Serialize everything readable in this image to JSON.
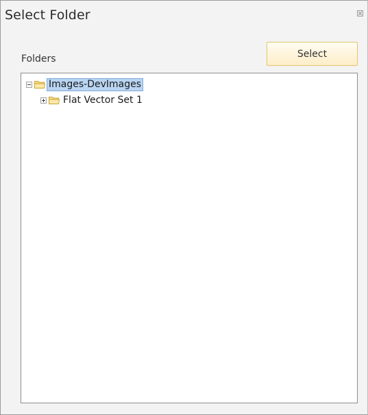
{
  "dialog": {
    "title": "Select Folder",
    "close_icon": "close-icon"
  },
  "toolbar": {
    "folders_label": "Folders",
    "select_label": "Select"
  },
  "tree": {
    "nodes": [
      {
        "label": "Images-DevImages",
        "expanded": true,
        "selected": true,
        "icon": "folder-icon"
      },
      {
        "label": "Flat Vector Set 1",
        "expanded": false,
        "selected": false,
        "icon": "folder-icon"
      }
    ]
  },
  "colors": {
    "selection": "#b9d5f2",
    "button_border": "#e3c56e",
    "folder": "#f2d06b"
  }
}
